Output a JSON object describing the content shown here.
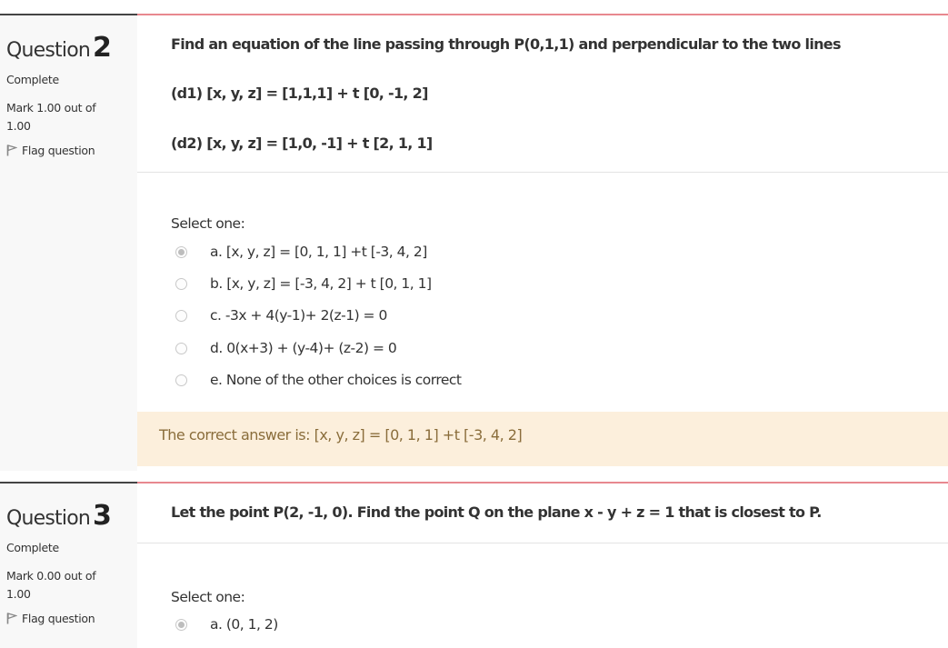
{
  "q2": {
    "label": "Question",
    "number": "2",
    "state": "Complete",
    "grade": "Mark 1.00 out of 1.00",
    "flag": "Flag question",
    "text": [
      "Find an equation of the line passing through P(0,1,1) and perpendicular to the two lines",
      "(d1) [x, y, z] = [1,1,1] + t [0, -1, 2]",
      "(d2) [x, y, z] = [1,0, -1] + t [2, 1, 1]"
    ],
    "prompt": "Select one:",
    "options": [
      "a. [x, y, z] = [0, 1, 1] +t [-3, 4, 2]",
      "b. [x, y, z] = [-3, 4, 2] + t [0, 1, 1]",
      "c. -3x + 4(y-1)+ 2(z-1) = 0",
      "d. 0(x+3) + (y-4)+ (z-2) = 0",
      "e. None of the other choices is correct"
    ],
    "selected_option": "a",
    "feedback": "The correct answer is: [x, y, z] = [0, 1, 1] +t [-3, 4, 2]"
  },
  "q3": {
    "label": "Question",
    "number": "3",
    "state": "Complete",
    "grade": "Mark 0.00 out of 1.00",
    "flag": "Flag question",
    "text": [
      "Let the point P(2, -1, 0). Find the point Q on the plane x - y + z = 1 that is  closest to P."
    ],
    "prompt": "Select one:",
    "options": [
      "a. (0, 1, 2)"
    ],
    "selected_option": "a"
  },
  "icons": {
    "flag": "flag-icon"
  },
  "colors": {
    "content_border": "#e8888f",
    "feedback_bg": "#fcefdc",
    "feedback_text": "#8a6d3b",
    "info_border": "#444444"
  }
}
